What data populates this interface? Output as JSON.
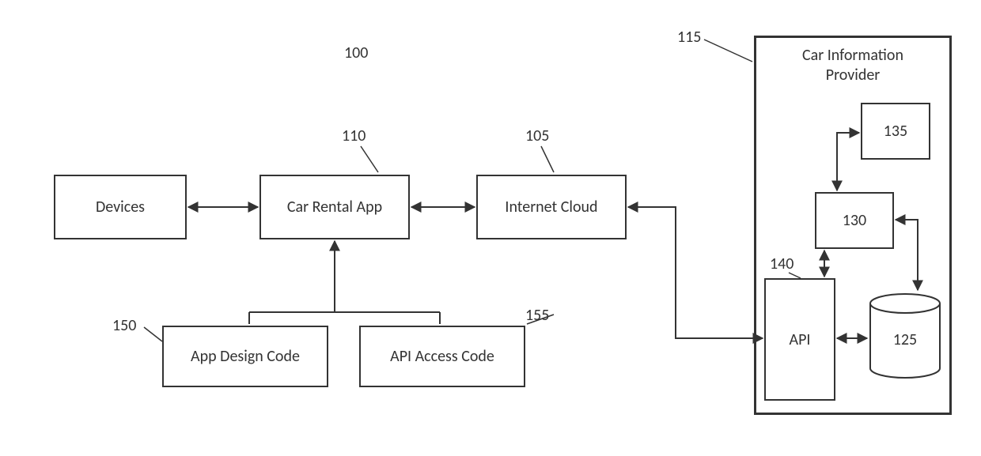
{
  "diagram_ref": "100",
  "boxes": {
    "devices": {
      "label": "Devices"
    },
    "car_rental_app": {
      "label": "Car Rental App",
      "ref": "110"
    },
    "internet_cloud": {
      "label": "Internet Cloud",
      "ref": "105"
    },
    "app_design": {
      "label": "App Design Code",
      "ref": "150"
    },
    "api_access": {
      "label": "API Access Code",
      "ref": "155"
    },
    "api": {
      "label": "API",
      "ref": "140"
    },
    "block130": {
      "label": "130"
    },
    "block135": {
      "label": "135"
    },
    "cylinder125": {
      "label": "125"
    }
  },
  "provider": {
    "title_line1": "Car Information",
    "title_line2": "Provider",
    "ref": "115"
  }
}
